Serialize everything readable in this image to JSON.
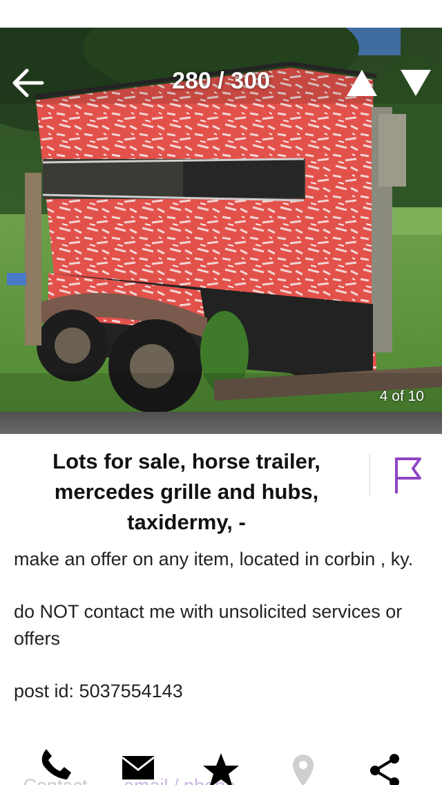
{
  "header": {
    "counter": "280 / 300",
    "photo_index": "4 of 10"
  },
  "listing": {
    "title": "Lots for sale, horse trailer, mercedes grille and hubs, taxidermy, -",
    "body": [
      "make an offer on any item, located in corbin , ky.",
      "do NOT contact me with unsolicited services or offers",
      "post id: 5037554143"
    ]
  },
  "actions": {
    "contact_label": "Contact",
    "email_label": "email / phone"
  },
  "icons": {
    "back": "back-arrow-icon",
    "prev": "triangle-up-icon",
    "next": "triangle-down-icon",
    "flag": "flag-icon",
    "phone": "phone-icon",
    "email": "envelope-icon",
    "favorite": "star-icon",
    "map": "map-pin-icon",
    "share": "share-icon"
  },
  "colors": {
    "accent": "#8e44c4",
    "trailer_red": "#e0453f"
  }
}
